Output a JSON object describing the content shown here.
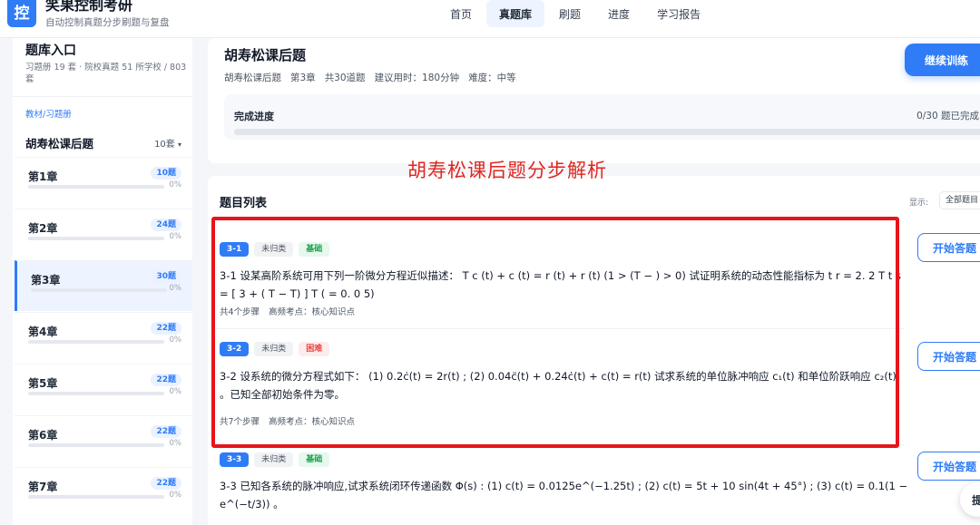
{
  "brand": {
    "logo_char": "控",
    "title": "笑果控制考研",
    "subtitle": "自动控制真题分步刷题与复盘"
  },
  "nav": {
    "items": [
      {
        "label": "首页",
        "active": false
      },
      {
        "label": "真题库",
        "active": true
      },
      {
        "label": "刷题",
        "active": false
      },
      {
        "label": "进度",
        "active": false
      },
      {
        "label": "学习报告",
        "active": false
      }
    ]
  },
  "sidebar": {
    "title": "题库入口",
    "meta": "习题册 19 套 · 院校真题 51 所学校 / 803 套",
    "group_label": "教材/习题册",
    "book": {
      "name": "胡寿松课后题",
      "count": "10套"
    },
    "chapters": [
      {
        "name": "第1章",
        "badge": "10题",
        "percent": "0%",
        "progress": 0,
        "active": false
      },
      {
        "name": "第2章",
        "badge": "24题",
        "percent": "0%",
        "progress": 0,
        "active": false
      },
      {
        "name": "第3章",
        "badge": "30题",
        "percent": "0%",
        "progress": 0,
        "active": true
      },
      {
        "name": "第4章",
        "badge": "22题",
        "percent": "0%",
        "progress": 0,
        "active": false
      },
      {
        "name": "第5章",
        "badge": "22题",
        "percent": "0%",
        "progress": 0,
        "active": false
      },
      {
        "name": "第6章",
        "badge": "22题",
        "percent": "0%",
        "progress": 0,
        "active": false
      },
      {
        "name": "第7章",
        "badge": "22题",
        "percent": "0%",
        "progress": 0,
        "active": false
      }
    ]
  },
  "header": {
    "title": "胡寿松课后题",
    "meta": [
      "胡寿松课后题",
      "第3章",
      "共30道题",
      "建议用时：180分钟",
      "难度：中等"
    ],
    "continue_label": "继续训练",
    "progress_label": "完成进度",
    "progress_status": "0/30 题已完成",
    "progress_fraction": 0
  },
  "annotation": {
    "title": "胡寿松课后题分步解析"
  },
  "list": {
    "title": "题目列表",
    "show_label": "显示:",
    "filter_value": "全部题目",
    "start_label": "开始答题",
    "questions": [
      {
        "num": "3-1",
        "category": "未归类",
        "difficulty": "基础",
        "text": "3-1 设某高阶系统可用下列一阶微分方程近似描述： T c (t) + c (t) = r (t) + r (t) (1 > (T − ) > 0) 试证明系统的动态性能指标为 t r = 2. 2 T t s = [ 3 + ( T − T) ] T ( = 0. 0 5)",
        "steps": "共4个步骤",
        "topic": "高频考点：核心知识点"
      },
      {
        "num": "3-2",
        "category": "未归类",
        "difficulty": "困难",
        "text": "3-2 设系统的微分方程式如下：  (1) 0.2ċ(t) = 2r(t) ; (2) 0.04c̈(t) + 0.24ċ(t) + c(t) = r(t) 试求系统的单位脉冲响应 c₁(t) 和单位阶跃响应 c₂(t) 。已知全部初始条件为零。",
        "steps": "共7个步骤",
        "topic": "高频考点：核心知识点"
      },
      {
        "num": "3-3",
        "category": "未归类",
        "difficulty": "基础",
        "text": "3-3 已知各系统的脉冲响应,试求系统闭环传递函数 Φ(s) : (1) c(t) = 0.0125e^(−1.25t) ; (2) c(t) = 5t + 10 sin(4t + 45°) ; (3) c(t) = 0.1(1 − e^(−t/3)) 。",
        "steps": "",
        "topic": ""
      }
    ]
  },
  "float_button": {
    "label": "提"
  },
  "colors": {
    "primary": "#2f7cf6",
    "highlight": "#e8141b",
    "easy": "#16a34a",
    "hard": "#ef4444"
  }
}
